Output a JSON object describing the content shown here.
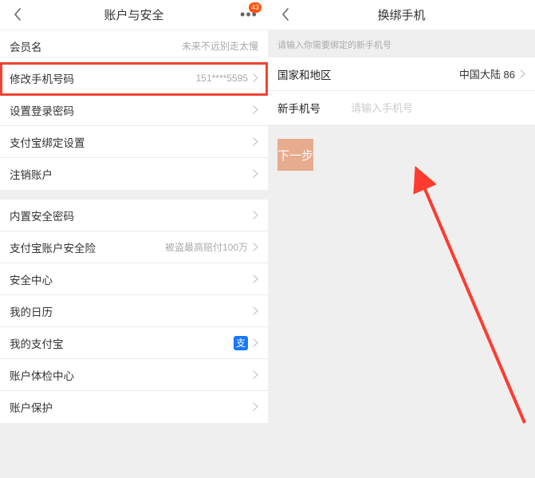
{
  "left": {
    "title": "账户与安全",
    "badge": "43",
    "groups": [
      [
        {
          "label": "会员名",
          "meta": "未来不远别走太慢",
          "chevron": false
        },
        {
          "label": "修改手机号码",
          "meta": "151****5595",
          "chevron": true,
          "highlight": true
        },
        {
          "label": "设置登录密码",
          "meta": "",
          "chevron": true
        },
        {
          "label": "支付宝绑定设置",
          "meta": "",
          "chevron": true
        },
        {
          "label": "注销账户",
          "meta": "",
          "chevron": true
        }
      ],
      [
        {
          "label": "内置安全密码",
          "meta": "",
          "chevron": true
        },
        {
          "label": "支付宝账户安全险",
          "meta": "被盗最高赔付100万",
          "chevron": true
        },
        {
          "label": "安全中心",
          "meta": "",
          "chevron": true
        },
        {
          "label": "我的日历",
          "meta": "",
          "chevron": true
        },
        {
          "label": "我的支付宝",
          "meta": "",
          "chevron": true,
          "alipay": true
        },
        {
          "label": "账户体检中心",
          "meta": "",
          "chevron": true
        },
        {
          "label": "账户保护",
          "meta": "",
          "chevron": true
        }
      ]
    ]
  },
  "right": {
    "title": "换绑手机",
    "hint": "请输入你需要绑定的新手机号",
    "country_label": "国家和地区",
    "country_value": "中国大陆 86",
    "phone_label": "新手机号",
    "phone_placeholder": "请输入手机号",
    "next_btn": "下一步"
  }
}
